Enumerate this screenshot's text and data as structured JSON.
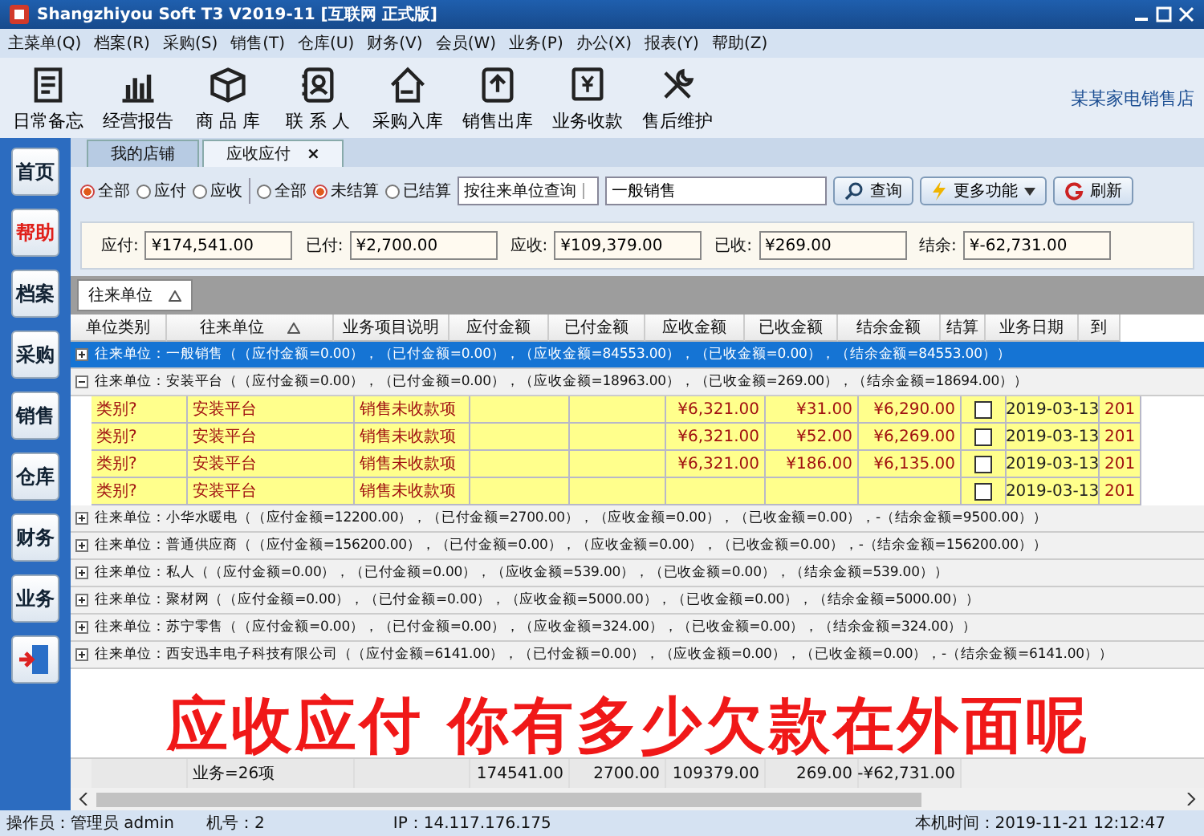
{
  "window": {
    "title": "Shangzhiyou Soft T3 V2019-11 [互联网 正式版]"
  },
  "menu": [
    "主菜单(Q)",
    "档案(R)",
    "采购(S)",
    "销售(T)",
    "仓库(U)",
    "财务(V)",
    "会员(W)",
    "业务(P)",
    "办公(X)",
    "报表(Y)",
    "帮助(Z)"
  ],
  "toolbar": [
    "日常备忘",
    "经营报告",
    "商 品 库",
    "联 系 人",
    "采购入库",
    "销售出库",
    "业务收款",
    "售后维护"
  ],
  "store_name": "某某家电销售店",
  "sidebar": [
    {
      "label": "首页",
      "highlighted": false
    },
    {
      "label": "帮助",
      "highlighted": true
    },
    {
      "label": "档案",
      "highlighted": false
    },
    {
      "label": "采购",
      "highlighted": false
    },
    {
      "label": "销售",
      "highlighted": false
    },
    {
      "label": "仓库",
      "highlighted": false
    },
    {
      "label": "财务",
      "highlighted": false
    },
    {
      "label": "业务",
      "highlighted": false
    }
  ],
  "tabs": [
    {
      "label": "我的店铺",
      "selected": false
    },
    {
      "label": "应收应付",
      "selected": true,
      "close": "×"
    }
  ],
  "filters": {
    "type_radios": [
      {
        "label": "全部",
        "selected": true
      },
      {
        "label": "应付",
        "selected": false
      },
      {
        "label": "应收",
        "selected": false
      }
    ],
    "settle_radios": [
      {
        "label": "全部",
        "selected": false
      },
      {
        "label": "未结算",
        "selected": true
      },
      {
        "label": "已结算",
        "selected": false
      }
    ],
    "query_mode": "按往来单位查询",
    "keyword": "一般销售",
    "buttons": [
      "查询",
      "更多功能",
      "刷新"
    ]
  },
  "summary": [
    {
      "label": "应付:",
      "value": "¥174,541.00"
    },
    {
      "label": "已付:",
      "value": "¥2,700.00"
    },
    {
      "label": "应收:",
      "value": "¥109,379.00"
    },
    {
      "label": "已收:",
      "value": "¥269.00"
    },
    {
      "label": "结余:",
      "value": "¥-62,731.00"
    }
  ],
  "group_by": "往来单位",
  "table": {
    "columns": [
      "单位类别",
      "往来单位",
      "业务项目说明",
      "应付金额",
      "已付金额",
      "应收金额",
      "已收金额",
      "结余金额",
      "结算",
      "业务日期",
      "到"
    ],
    "rows": [
      {
        "kind": "group",
        "selected": true,
        "expanded": false,
        "text": "往来单位：一般销售（（应付金额=0.00），（已付金额=0.00），（应收金额=84553.00），（已收金额=0.00），（结余金额=84553.00））"
      },
      {
        "kind": "group",
        "selected": false,
        "expanded": true,
        "text": "往来单位：安装平台（（应付金额=0.00），（已付金额=0.00），（应收金额=18963.00），（已收金额=269.00），（结余金额=18694.00））"
      },
      {
        "kind": "data",
        "checked": false,
        "cells": [
          "类别?",
          "安装平台",
          "销售未收款项",
          "",
          "",
          "¥6,321.00",
          "¥31.00",
          "¥6,290.00",
          "2019-03-13",
          "201"
        ]
      },
      {
        "kind": "data",
        "checked": false,
        "cells": [
          "类别?",
          "安装平台",
          "销售未收款项",
          "",
          "",
          "¥6,321.00",
          "¥52.00",
          "¥6,269.00",
          "2019-03-13",
          "201"
        ]
      },
      {
        "kind": "data",
        "checked": false,
        "cells": [
          "类别?",
          "安装平台",
          "销售未收款项",
          "",
          "",
          "¥6,321.00",
          "¥186.00",
          "¥6,135.00",
          "2019-03-13",
          "201"
        ]
      },
      {
        "kind": "data",
        "checked": false,
        "cells": [
          "类别?",
          "安装平台",
          "销售未收款项",
          "",
          "",
          "",
          "",
          "",
          "2019-03-13",
          "201"
        ]
      },
      {
        "kind": "group",
        "selected": false,
        "expanded": false,
        "text": "往来单位：小华水暖电（（应付金额=12200.00），（已付金额=2700.00），（应收金额=0.00），（已收金额=0.00），-（结余金额=9500.00））"
      },
      {
        "kind": "group",
        "selected": false,
        "expanded": false,
        "text": "往来单位：普通供应商（（应付金额=156200.00），（已付金额=0.00），（应收金额=0.00），（已收金额=0.00），-（结余金额=156200.00））"
      },
      {
        "kind": "group",
        "selected": false,
        "expanded": false,
        "text": "往来单位：私人（（应付金额=0.00），（已付金额=0.00），（应收金额=539.00），（已收金额=0.00），（结余金额=539.00））"
      },
      {
        "kind": "group",
        "selected": false,
        "expanded": false,
        "text": "往来单位：聚材网（（应付金额=0.00），（已付金额=0.00），（应收金额=5000.00），（已收金额=0.00），（结余金额=5000.00））"
      },
      {
        "kind": "group",
        "selected": false,
        "expanded": false,
        "text": "往来单位：苏宁零售（（应付金额=0.00），（已付金额=0.00），（应收金额=324.00），（已收金额=0.00），（结余金额=324.00））"
      },
      {
        "kind": "group",
        "selected": false,
        "expanded": false,
        "text": "往来单位：西安迅丰电子科技有限公司（（应付金额=6141.00），（已付金额=0.00），（应收金额=0.00），（已收金额=0.00），-（结余金额=6141.00））"
      }
    ],
    "totals": {
      "count": "业务=26项",
      "amounts": [
        "174541.00",
        "2700.00",
        "109379.00",
        "269.00",
        "-¥62,731.00"
      ]
    }
  },
  "caption": "应收应付 你有多少欠款在外面呢",
  "status_bar": [
    "操作员：管理员 admin",
    "机号：2",
    "IP：14.117.176.175",
    "本机时间：2019-11-21 12:12:47"
  ]
}
